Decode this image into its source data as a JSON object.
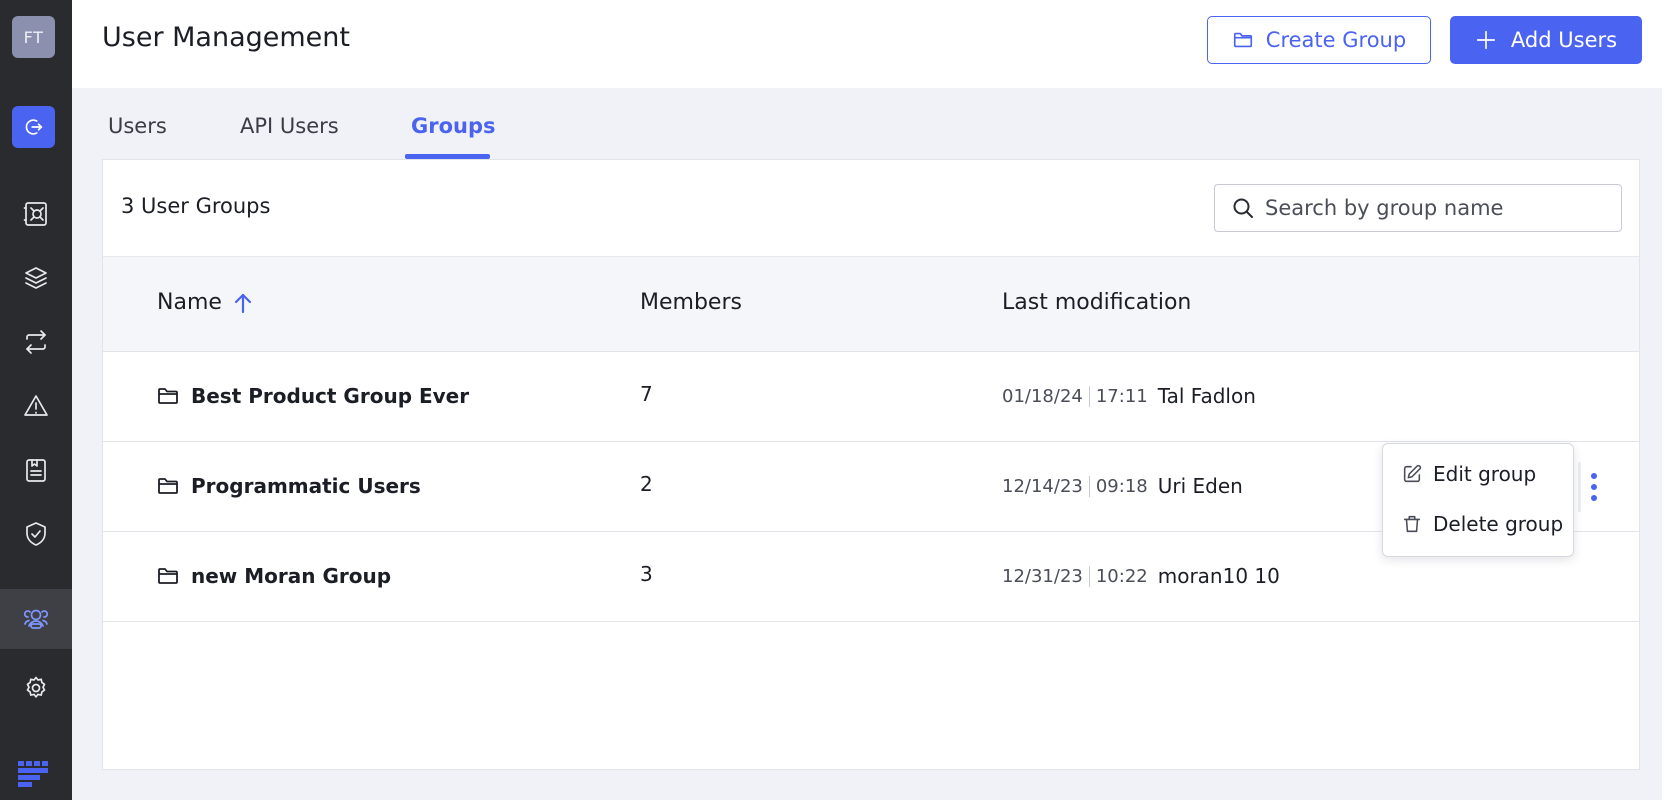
{
  "sidebar": {
    "avatar_initials": "FT",
    "nav": [
      {
        "icon": "exit-icon"
      },
      {
        "icon": "vault-icon"
      },
      {
        "icon": "layers-icon"
      },
      {
        "icon": "sync-icon"
      },
      {
        "icon": "alert-triangle-icon"
      },
      {
        "icon": "report-icon"
      },
      {
        "icon": "shield-check-icon"
      },
      {
        "icon": "users-icon"
      },
      {
        "icon": "gear-icon"
      }
    ],
    "active_color": "#7f95ff"
  },
  "header": {
    "title": "User Management",
    "create_group_label": "Create Group",
    "add_users_label": "Add Users"
  },
  "tabs": [
    {
      "label": "Users"
    },
    {
      "label": "API Users"
    },
    {
      "label": "Groups",
      "active": true
    }
  ],
  "card": {
    "count_label": "3 User Groups",
    "search_placeholder": "Search by group name"
  },
  "table": {
    "columns": [
      "Name",
      "Members",
      "Last modification"
    ],
    "sort": {
      "column": "Name",
      "direction": "ascending"
    },
    "rows": [
      {
        "name": "Best Product Group Ever",
        "members": "7",
        "date": "01/18/24",
        "time": "17:11",
        "user": "Tal Fadlon"
      },
      {
        "name": "Programmatic Users",
        "members": "2",
        "date": "12/14/23",
        "time": "09:18",
        "user": "Uri Eden"
      },
      {
        "name": "new Moran Group",
        "members": "3",
        "date": "12/31/23",
        "time": "10:22",
        "user": "moran10 10"
      }
    ]
  },
  "context_menu": {
    "items": [
      {
        "label": "Edit group",
        "icon": "edit-icon"
      },
      {
        "label": "Delete group",
        "icon": "trash-icon"
      }
    ]
  },
  "colors": {
    "accent": "#4a63f0",
    "sidebar_bg": "#2a2b2e"
  }
}
